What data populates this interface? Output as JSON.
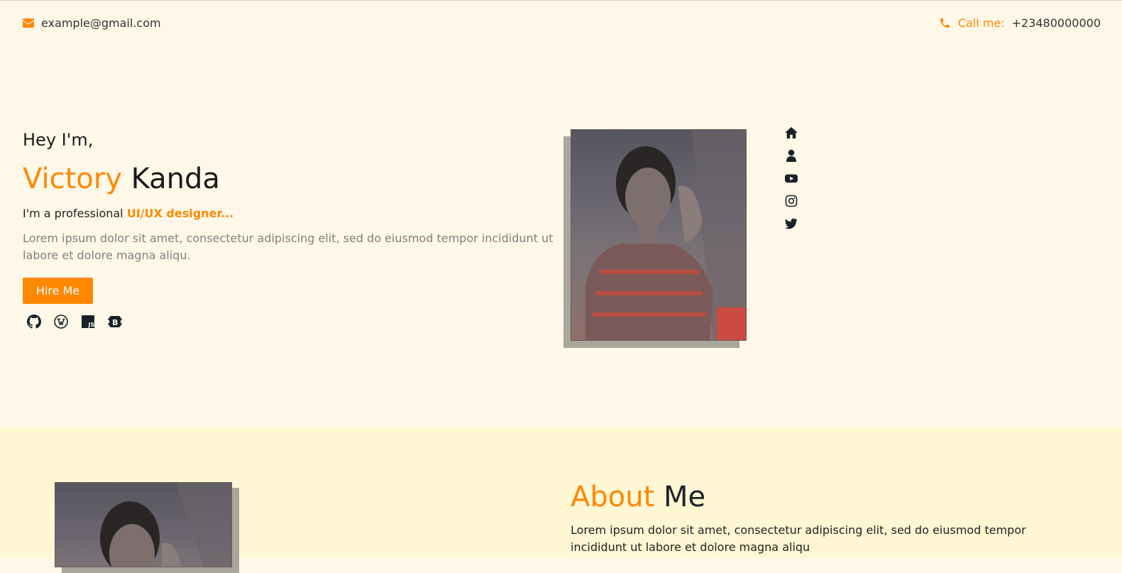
{
  "header": {
    "email": "example@gmail.com",
    "call_label": "Call me:",
    "phone": "+23480000000"
  },
  "hero": {
    "greeting": "Hey I'm,",
    "first_name": "Victory",
    "last_name": "Kanda",
    "role_prefix": "I'm a professional",
    "role_typed": "UI/UX designer...",
    "description": "Lorem ipsum dolor sit amet, consectetur adipiscing elit, sed do eiusmod tempor incididunt ut labore et dolore magna aliqu.",
    "hire_button": "Hire Me",
    "skill_icons": [
      "github-icon",
      "wordpress-icon",
      "javascript-icon",
      "bootstrap-icon"
    ]
  },
  "side_nav": [
    "home-icon",
    "user-icon",
    "youtube-icon",
    "instagram-icon",
    "twitter-icon"
  ],
  "about": {
    "title_accent": "About",
    "title_rest": "Me",
    "text": "Lorem ipsum dolor sit amet, consectetur adipiscing elit, sed do eiusmod tempor incididunt ut labore et dolore magna aliqu"
  },
  "colors": {
    "accent": "#ff8800",
    "hero_bg": "#fff8e9",
    "about_bg": "#fff6d4",
    "photo_shadow": "#a9a79c"
  }
}
